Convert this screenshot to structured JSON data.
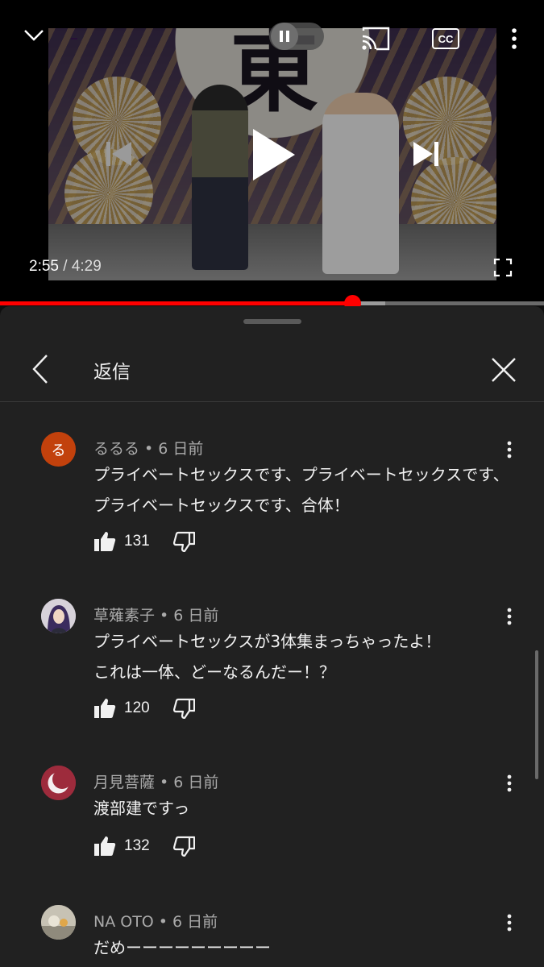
{
  "player": {
    "current_time": "2:55",
    "duration": "/ 4:29",
    "progress_fraction": 0.647,
    "buffered_fraction": 0.708,
    "video_overlay_text": "東",
    "icons": {
      "collapse": "chevron-down-icon",
      "pause": "pause-icon",
      "cast": "cast-icon",
      "captions": "cc-icon",
      "more": "more-vert-icon",
      "previous": "skip-previous-icon",
      "play": "play-icon",
      "next": "skip-next-icon",
      "fullscreen": "fullscreen-icon"
    },
    "captions_label": "CC"
  },
  "panel": {
    "title": "返信",
    "icons": {
      "back": "chevron-left-icon",
      "close": "close-icon"
    }
  },
  "comments": [
    {
      "author": "るるる",
      "time": "6 日前",
      "meta": "るるる • 6 日前",
      "avatar_letter": "る",
      "avatar_color": "#c2410c",
      "text": "プライベートセックスです、プライベートセックスです、プライベートセックスです、合体！",
      "likes": "131"
    },
    {
      "author": "草薙素子",
      "time": "6 日前",
      "meta": "草薙素子 • 6 日前",
      "text": "プライベートセックスが3体集まっちゃったよ！\nこれは一体、どーなるんだー！？",
      "likes": "120"
    },
    {
      "author": "月見菩薩",
      "time": "6 日前",
      "meta": "月見菩薩 • 6 日前",
      "text": "渡部建ですっ",
      "likes": "132"
    },
    {
      "author": "NA OTO",
      "time": "6 日前",
      "meta": "NA OTO • 6 日前",
      "text": "だめーーーーーーーーー"
    }
  ],
  "colors": {
    "accent": "#ff0000",
    "panel_bg": "#212121",
    "text_primary": "#f1f1f1",
    "text_secondary": "#aaaaaa"
  }
}
